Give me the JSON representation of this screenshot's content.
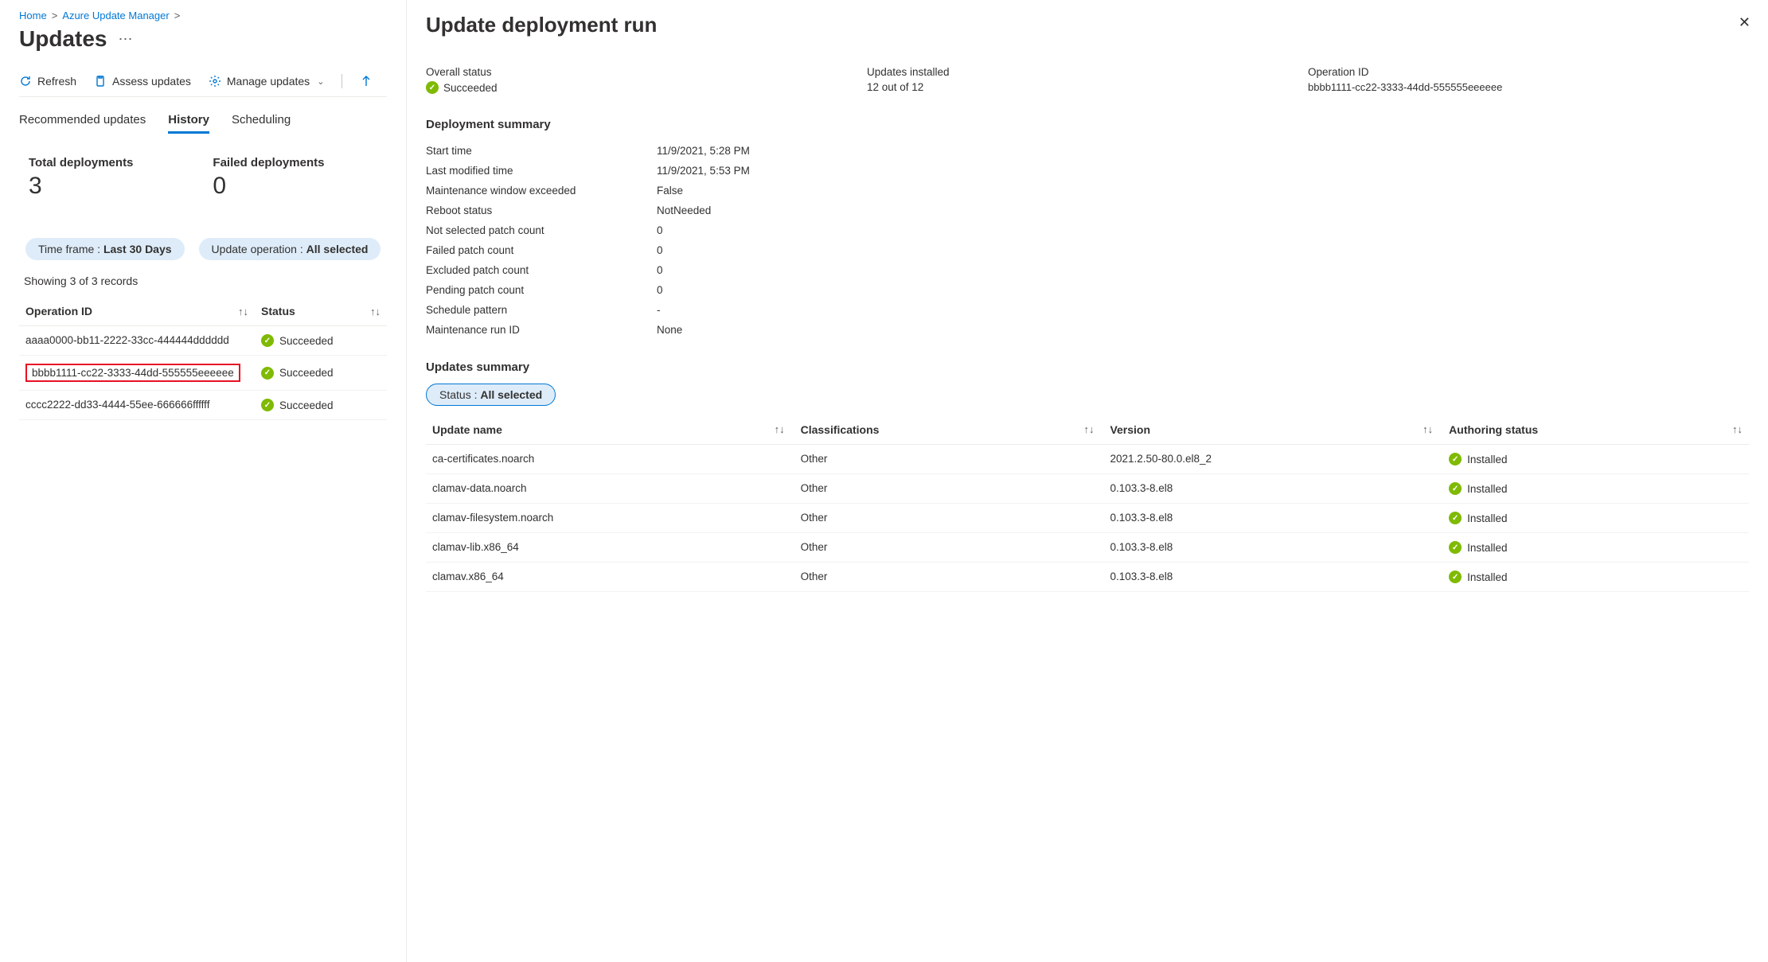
{
  "breadcrumb": {
    "home": "Home",
    "service": "Azure Update Manager"
  },
  "page_title": "Updates",
  "toolbar": {
    "refresh": "Refresh",
    "assess": "Assess updates",
    "manage": "Manage updates"
  },
  "tabs": {
    "recommended": "Recommended updates",
    "history": "History",
    "scheduling": "Scheduling"
  },
  "stats": {
    "total_label": "Total deployments",
    "total_value": "3",
    "failed_label": "Failed deployments",
    "failed_value": "0"
  },
  "filters": {
    "timeframe_label": "Time frame : ",
    "timeframe_value": "Last 30 Days",
    "op_label": "Update operation : ",
    "op_value": "All selected"
  },
  "records_text": "Showing 3 of 3 records",
  "table": {
    "col_op": "Operation ID",
    "col_status": "Status",
    "rows": [
      {
        "id": "aaaa0000-bb11-2222-33cc-444444dddddd",
        "status": "Succeeded",
        "highlight": false
      },
      {
        "id": "bbbb1111-cc22-3333-44dd-555555eeeeee",
        "status": "Succeeded",
        "highlight": true
      },
      {
        "id": "cccc2222-dd33-4444-55ee-666666ffffff",
        "status": "Succeeded",
        "highlight": false
      }
    ]
  },
  "panel": {
    "title": "Update deployment run",
    "overview": {
      "overall_label": "Overall status",
      "overall_value": "Succeeded",
      "installed_label": "Updates installed",
      "installed_value": "12 out of 12",
      "opid_label": "Operation ID",
      "opid_value": "bbbb1111-cc22-3333-44dd-555555eeeeee"
    },
    "deploy_summary_title": "Deployment summary",
    "deploy_summary": [
      {
        "k": "Start time",
        "v": "11/9/2021, 5:28 PM"
      },
      {
        "k": "Last modified time",
        "v": "11/9/2021, 5:53 PM"
      },
      {
        "k": "Maintenance window exceeded",
        "v": "False"
      },
      {
        "k": "Reboot status",
        "v": "NotNeeded"
      },
      {
        "k": "Not selected patch count",
        "v": "0"
      },
      {
        "k": "Failed patch count",
        "v": "0"
      },
      {
        "k": "Excluded patch count",
        "v": "0"
      },
      {
        "k": "Pending patch count",
        "v": "0"
      },
      {
        "k": "Schedule pattern",
        "v": "-"
      },
      {
        "k": "Maintenance run ID",
        "v": "None"
      }
    ],
    "updates_summary_title": "Updates summary",
    "status_filter_label": "Status : ",
    "status_filter_value": "All selected",
    "cols": {
      "name": "Update name",
      "cls": "Classifications",
      "ver": "Version",
      "auth": "Authoring status"
    },
    "updates": [
      {
        "name": "ca-certificates.noarch",
        "cls": "Other",
        "ver": "2021.2.50-80.0.el8_2",
        "auth": "Installed"
      },
      {
        "name": "clamav-data.noarch",
        "cls": "Other",
        "ver": "0.103.3-8.el8",
        "auth": "Installed"
      },
      {
        "name": "clamav-filesystem.noarch",
        "cls": "Other",
        "ver": "0.103.3-8.el8",
        "auth": "Installed"
      },
      {
        "name": "clamav-lib.x86_64",
        "cls": "Other",
        "ver": "0.103.3-8.el8",
        "auth": "Installed"
      },
      {
        "name": "clamav.x86_64",
        "cls": "Other",
        "ver": "0.103.3-8.el8",
        "auth": "Installed"
      }
    ]
  }
}
